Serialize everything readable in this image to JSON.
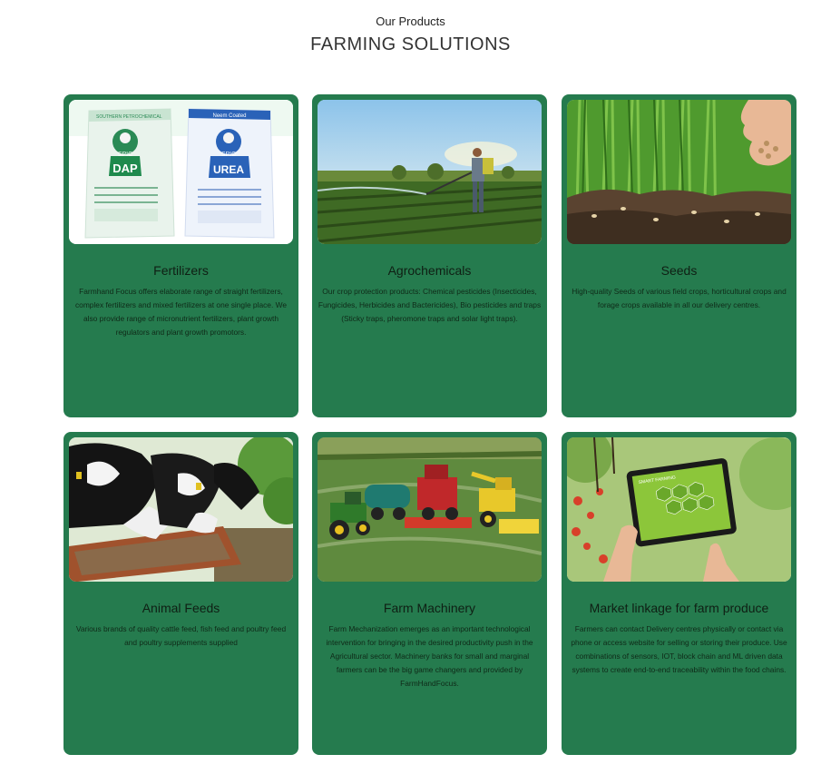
{
  "section": {
    "eyebrow": "Our Products",
    "title": "FARMING SOLUTIONS"
  },
  "colors": {
    "card_background": "#257b4e",
    "card_text": "#0f1f14"
  },
  "cards": [
    {
      "title": "Fertilizers",
      "description": "Farmhand Focus offers elaborate range of straight fertilizers, complex fertilizers and mixed fertilizers at one single place. We also provide range of micronutrient fertilizers, plant growth regulators and plant growth promotors.",
      "image": "fertilizer-bags-image",
      "image_labels": {
        "left_brand": "SPIC",
        "left_product": "DAP",
        "right_tag": "Neem Coated",
        "right_brand": "SPIC",
        "right_product": "UREA"
      }
    },
    {
      "title": "Agrochemicals",
      "description": "Our crop protection products: Chemical pesticides (Insecticides, Fungicides, Herbicides and Bactericides), Bio pesticides and traps (Sticky traps, pheromone traps and solar light traps).",
      "image": "farmer-spraying-field-image"
    },
    {
      "title": "Seeds",
      "description": "High-quality Seeds of various field crops, horticultural crops and forage crops available in all our delivery centres.",
      "image": "seeds-in-soil-image"
    },
    {
      "title": "Animal Feeds",
      "description": "Various brands of quality cattle feed, fish feed and poultry feed and poultry supplements supplied",
      "image": "cows-feeding-image"
    },
    {
      "title": "Farm Machinery",
      "description": "Farm Mechanization emerges as an important technological intervention for bringing in the desired productivity push in the Agricultural sector. Machinery banks for small and marginal farmers can be the big game changers and provided by FarmHandFocus.",
      "image": "tractors-harvesters-image"
    },
    {
      "title": "Market linkage for farm produce",
      "description": "Farmers can contact Delivery centres physically or contact via phone or access website for selling or storing their produce. Use combinations of sensors, IOT, block chain and ML driven data systems to create end-to-end traceability within the food chains.",
      "image": "smart-farming-tablet-image",
      "image_labels": {
        "tablet_heading": "SMART FARMING"
      }
    }
  ]
}
